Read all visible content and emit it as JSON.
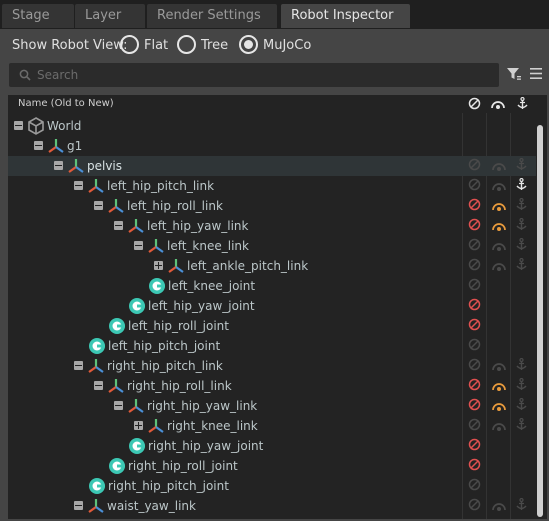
{
  "tabs": [
    {
      "label": "Stage",
      "active": false
    },
    {
      "label": "Layer",
      "active": false
    },
    {
      "label": "Render Settings",
      "active": false
    },
    {
      "label": "Robot Inspector",
      "active": true
    }
  ],
  "view": {
    "label": "Show Robot View:",
    "options": [
      {
        "label": "Flat",
        "selected": false
      },
      {
        "label": "Tree",
        "selected": false
      },
      {
        "label": "MuJoCo",
        "selected": true
      }
    ]
  },
  "search": {
    "placeholder": "Search"
  },
  "tree": {
    "header": "Name (Old to New)",
    "column_icons": [
      "disable-icon",
      "joint-limit-icon",
      "anchor-icon"
    ],
    "colors": {
      "link_icon_red": "#e05a3a",
      "link_icon_green": "#5ec27a",
      "link_icon_blue": "#4a8fd6",
      "joint_icon": "#3cc7b3",
      "active_red": "#e05050",
      "active_orange": "#e89a3c",
      "active_white": "#e6e6e6",
      "dim": "#4a4a4a",
      "selected_row": "#2f3537"
    },
    "rows": [
      {
        "label": "World",
        "depth": 0,
        "expander": "minus",
        "kind": "world",
        "selected": false,
        "flags": [
          "none",
          "none",
          "none"
        ]
      },
      {
        "label": "g1",
        "depth": 1,
        "expander": "minus",
        "kind": "link",
        "selected": false,
        "flags": [
          "none",
          "none",
          "none"
        ]
      },
      {
        "label": "pelvis",
        "depth": 2,
        "expander": "minus",
        "kind": "link",
        "selected": true,
        "flags": [
          "dim",
          "dim",
          "dim"
        ]
      },
      {
        "label": "left_hip_pitch_link",
        "depth": 3,
        "expander": "minus",
        "kind": "link",
        "selected": false,
        "flags": [
          "dim",
          "dim",
          "white"
        ]
      },
      {
        "label": "left_hip_roll_link",
        "depth": 4,
        "expander": "minus",
        "kind": "link",
        "selected": false,
        "flags": [
          "red",
          "orange",
          "dim"
        ]
      },
      {
        "label": "left_hip_yaw_link",
        "depth": 5,
        "expander": "minus",
        "kind": "link",
        "selected": false,
        "flags": [
          "red",
          "orange",
          "dim"
        ]
      },
      {
        "label": "left_knee_link",
        "depth": 6,
        "expander": "minus",
        "kind": "link",
        "selected": false,
        "flags": [
          "dim",
          "dim",
          "dim"
        ]
      },
      {
        "label": "left_ankle_pitch_link",
        "depth": 7,
        "expander": "plus",
        "kind": "link",
        "selected": false,
        "flags": [
          "dim",
          "dim",
          "dim"
        ]
      },
      {
        "label": "left_knee_joint",
        "depth": 7,
        "expander": "none",
        "kind": "joint",
        "selected": false,
        "flags": [
          "dim",
          "none",
          "none"
        ]
      },
      {
        "label": "left_hip_yaw_joint",
        "depth": 6,
        "expander": "none",
        "kind": "joint",
        "selected": false,
        "flags": [
          "red",
          "none",
          "none"
        ]
      },
      {
        "label": "left_hip_roll_joint",
        "depth": 5,
        "expander": "none",
        "kind": "joint",
        "selected": false,
        "flags": [
          "red",
          "none",
          "none"
        ]
      },
      {
        "label": "left_hip_pitch_joint",
        "depth": 4,
        "expander": "none",
        "kind": "joint",
        "selected": false,
        "flags": [
          "dim",
          "none",
          "none"
        ]
      },
      {
        "label": "right_hip_pitch_link",
        "depth": 3,
        "expander": "minus",
        "kind": "link",
        "selected": false,
        "flags": [
          "dim",
          "dim",
          "dim"
        ]
      },
      {
        "label": "right_hip_roll_link",
        "depth": 4,
        "expander": "minus",
        "kind": "link",
        "selected": false,
        "flags": [
          "red",
          "orange",
          "dim"
        ]
      },
      {
        "label": "right_hip_yaw_link",
        "depth": 5,
        "expander": "minus",
        "kind": "link",
        "selected": false,
        "flags": [
          "red",
          "orange",
          "dim"
        ]
      },
      {
        "label": "right_knee_link",
        "depth": 6,
        "expander": "plus",
        "kind": "link",
        "selected": false,
        "flags": [
          "dim",
          "dim",
          "dim"
        ]
      },
      {
        "label": "right_hip_yaw_joint",
        "depth": 6,
        "expander": "none",
        "kind": "joint",
        "selected": false,
        "flags": [
          "red",
          "none",
          "none"
        ]
      },
      {
        "label": "right_hip_roll_joint",
        "depth": 5,
        "expander": "none",
        "kind": "joint",
        "selected": false,
        "flags": [
          "red",
          "none",
          "none"
        ]
      },
      {
        "label": "right_hip_pitch_joint",
        "depth": 4,
        "expander": "none",
        "kind": "joint",
        "selected": false,
        "flags": [
          "dim",
          "none",
          "none"
        ]
      },
      {
        "label": "waist_yaw_link",
        "depth": 3,
        "expander": "minus",
        "kind": "link",
        "selected": false,
        "flags": [
          "dim",
          "dim",
          "dim"
        ]
      }
    ]
  }
}
